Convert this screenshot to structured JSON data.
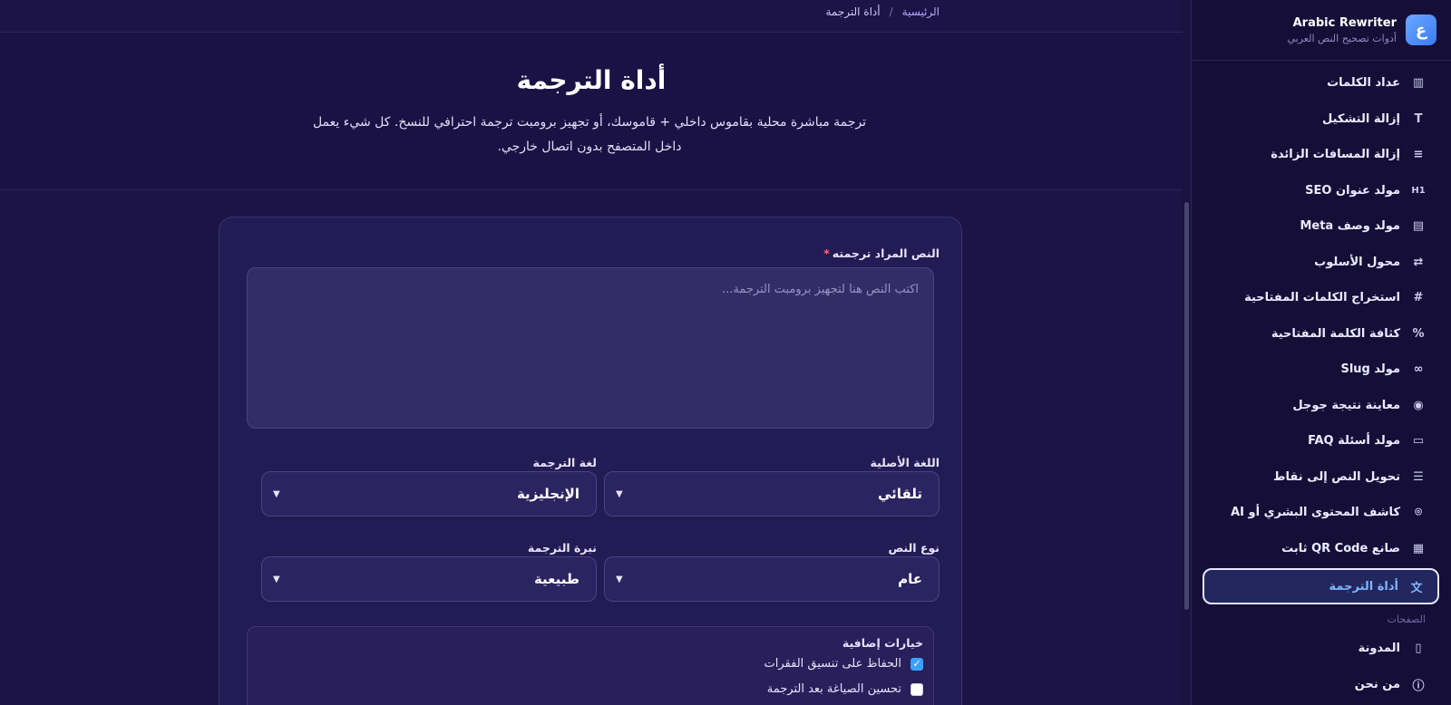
{
  "brand": {
    "title": "Arabic Rewriter",
    "subtitle": "أدوات تصحيح النص العربي",
    "logo_letter": "ع"
  },
  "breadcrumb": {
    "home": "الرئيسية",
    "separator": "/",
    "current": "أداة الترجمة"
  },
  "hero": {
    "title": "أداة الترجمة",
    "description": "ترجمة مباشرة محلية بقاموس داخلي + قاموسك، أو تجهيز برومبت ترجمة احترافي للنسخ. كل شيء يعمل داخل المتصفح بدون اتصال خارجي."
  },
  "sidebar": {
    "items": [
      {
        "label": "عداد الكلمات",
        "icon": "bar-chart-icon"
      },
      {
        "label": "إزالة التشكيل",
        "icon": "type-icon"
      },
      {
        "label": "إزالة المسافات الزائدة",
        "icon": "lines-icon"
      },
      {
        "label": "مولد عنوان SEO",
        "icon": "heading-icon"
      },
      {
        "label": "مولد وصف Meta",
        "icon": "file-icon"
      },
      {
        "label": "محول الأسلوب",
        "icon": "repeat-icon"
      },
      {
        "label": "استخراج الكلمات المفتاحية",
        "icon": "hash-icon"
      },
      {
        "label": "كثافة الكلمة المفتاحية",
        "icon": "percent-icon"
      },
      {
        "label": "مولد Slug",
        "icon": "link-icon"
      },
      {
        "label": "معاينة نتيجة جوجل",
        "icon": "eye-icon"
      },
      {
        "label": "مولد أسئلة FAQ",
        "icon": "message-icon"
      },
      {
        "label": "تحويل النص إلى نقاط",
        "icon": "list-icon"
      },
      {
        "label": "كاشف المحتوى البشري أو AI",
        "icon": "scan-icon"
      },
      {
        "label": "صانع QR Code ثابت",
        "icon": "qr-icon"
      },
      {
        "label": "أداة الترجمة",
        "icon": "translate-icon",
        "active": true
      }
    ],
    "section_label": "الصفحات",
    "pages": [
      {
        "label": "المدونة",
        "icon": "book-icon"
      },
      {
        "label": "من نحن",
        "icon": "info-icon"
      }
    ]
  },
  "form": {
    "text_label": "النص المراد ترجمته",
    "required_mark": "*",
    "text_placeholder": "اكتب النص هنا لتجهيز برومبت الترجمة...",
    "source_lang_label": "اللغة الأصلية",
    "source_lang_value": "تلقائي",
    "target_lang_label": "لغة الترجمة",
    "target_lang_value": "الإنجليزية",
    "text_type_label": "نوع النص",
    "text_type_value": "عام",
    "tone_label": "نبرة الترجمة",
    "tone_value": "طبيعية",
    "extra_options_label": "خيارات إضافية",
    "options": [
      {
        "label": "الحفاظ على تنسيق الفقرات",
        "checked": true
      },
      {
        "label": "تحسين الصياغة بعد الترجمة",
        "checked": false
      }
    ]
  },
  "colors": {
    "background": "#1c1446",
    "sidebar": "#150f38",
    "accent": "#7fb6ff",
    "checkbox": "#3aa0ff"
  }
}
